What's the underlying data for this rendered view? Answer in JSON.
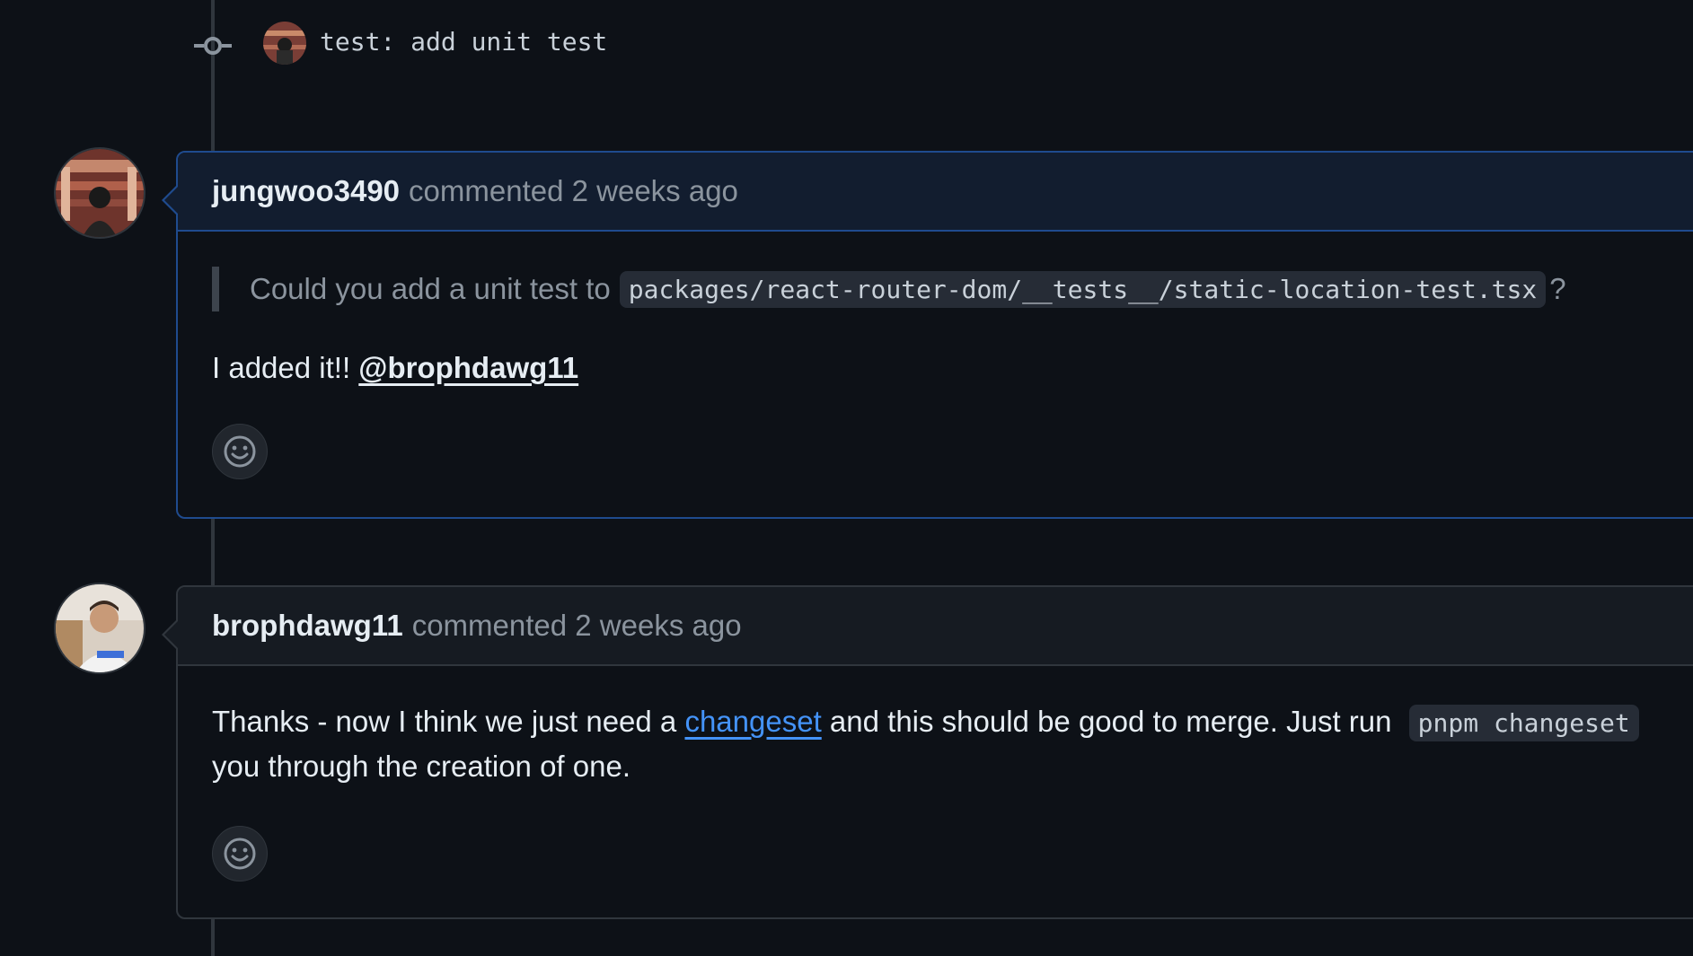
{
  "commit": {
    "message": "test: add unit test"
  },
  "comments": [
    {
      "author": "jungwoo3490",
      "meta": "commented 2 weeks ago",
      "quote_text": "Could you add a unit test to",
      "quote_code": "packages/react-router-dom/__tests__/static-location-test.tsx",
      "quote_end": "?",
      "body_text": "I added it!!",
      "mention": "@brophdawg11"
    },
    {
      "author": "brophdawg11",
      "meta": "commented 2 weeks ago",
      "body_before_link": "Thanks - now I think we just need a",
      "link_text": "changeset",
      "body_after_link": "and this should be good to merge. Just run",
      "body_code": "pnpm changeset",
      "body_line2": "you through the creation of one."
    }
  ],
  "colors": {
    "background": "#0d1117",
    "highlight_border": "#1f4b8e",
    "link": "#4493f8"
  },
  "icons": [
    "git-commit-icon",
    "smiley-icon"
  ]
}
